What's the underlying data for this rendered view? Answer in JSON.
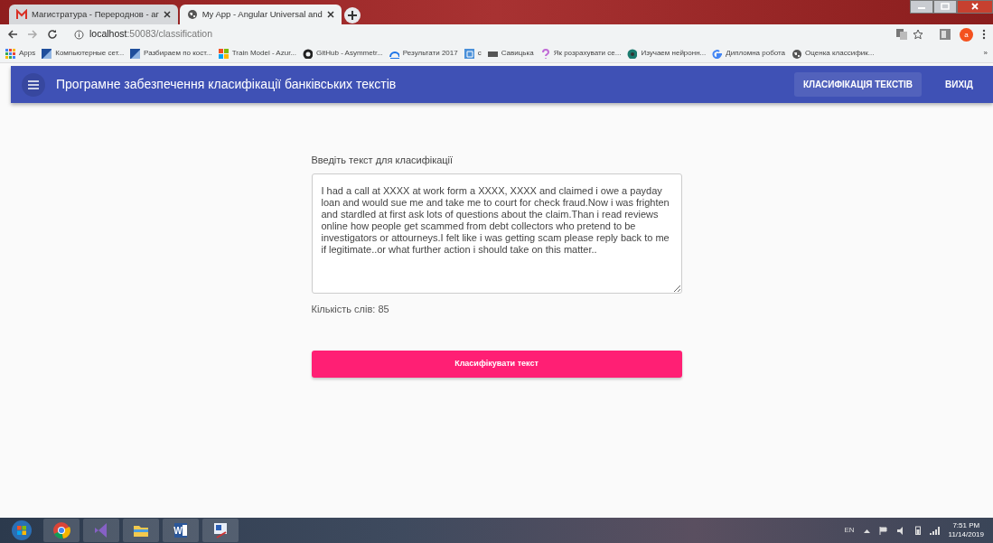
{
  "browser": {
    "tabs": [
      {
        "title": "Магистратура - Перероднов - ar",
        "kind": "mail",
        "selected": false
      },
      {
        "title": "My App - Angular Universal and",
        "kind": "globe",
        "selected": true
      }
    ],
    "address": {
      "host": "localhost",
      "rest": ":50083/classification"
    },
    "bookmarks": [
      {
        "label": "Apps",
        "kind": "apps"
      },
      {
        "label": "Компьютерные сет...",
        "kind": "flag"
      },
      {
        "label": "Разбираем по кост...",
        "kind": "flag"
      },
      {
        "label": "Train Model - Azur...",
        "kind": "tiles"
      },
      {
        "label": "GitHub - Asymmetr...",
        "kind": "github"
      },
      {
        "label": "Результати 2017",
        "kind": "chart"
      },
      {
        "label": "c",
        "kind": "grid"
      },
      {
        "label": "Савицька",
        "kind": "pkp"
      },
      {
        "label": "Як розрахувати се...",
        "kind": "question"
      },
      {
        "label": "Изучаем нейронн...",
        "kind": "dot"
      },
      {
        "label": "Дипломна робота",
        "kind": "google"
      },
      {
        "label": "Оценка классифик...",
        "kind": "globe"
      }
    ],
    "more": "»",
    "profile": "a"
  },
  "app": {
    "title": "Програмне забезпечення класифікації банківських текстів",
    "nav": [
      {
        "label": "КЛАСИФІКАЦІЯ ТЕКСТІВ",
        "selected": true
      },
      {
        "label": "ВИХІД",
        "selected": false
      }
    ],
    "form": {
      "label": "Введіть текст для класифікації",
      "text": "I had a call at XXXX at work form a XXXX, XXXX and claimed i owe a payday loan and would sue me and take me to court for check fraud.Now i was frighten and stardled at first ask lots of questions about the claim.Than i read reviews online how people get scammed from debt collectors who pretend to be investigators or attourneys.I felt like i was getting scam please reply back to me if legitimate..or what further action i should take on this matter..",
      "word_count": "Кількість слів: 85",
      "submit": "Класифікувати текст"
    }
  },
  "taskbar": {
    "apps": [
      {
        "kind": "chrome"
      },
      {
        "kind": "studio"
      },
      {
        "kind": "folder"
      },
      {
        "kind": "word",
        "letter": "W"
      },
      {
        "kind": "paint"
      }
    ],
    "language": "EN",
    "time": "7:51 PM",
    "date": "11/14/2019"
  }
}
